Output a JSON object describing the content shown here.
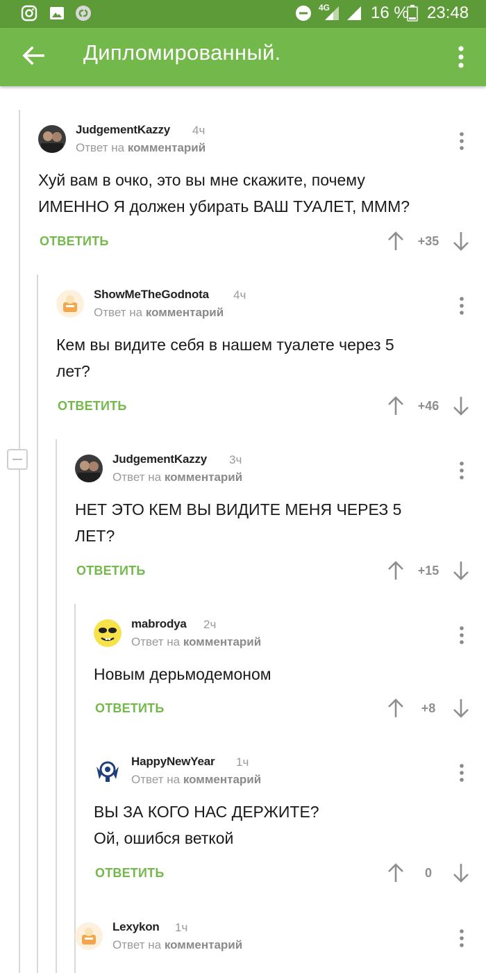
{
  "status_bar": {
    "battery": "16 %",
    "time": "23:48",
    "network": "4G"
  },
  "app_bar": {
    "title": "Дипломированный."
  },
  "reply_label": "ОТВЕТИТЬ",
  "reply_to_prefix": "Ответ на",
  "reply_to_target": "комментарий",
  "comments": [
    {
      "author": "JudgementKazzy",
      "time": "4ч",
      "lines": [
        "Хуй вам в очко, это вы мне скажите, почему",
        "ИМЕННО Я должен убирать ВАШ ТУАЛЕТ, МММ?"
      ],
      "score": "+35",
      "avatar": "photo"
    },
    {
      "author": "ShowMeTheGodnota",
      "time": "4ч",
      "lines": [
        "Кем вы видите себя в нашем туалете через 5",
        "лет?"
      ],
      "score": "+46",
      "avatar": "default"
    },
    {
      "author": "JudgementKazzy",
      "time": "3ч",
      "lines": [
        "НЕТ ЭТО КЕМ ВЫ ВИДИТЕ МЕНЯ ЧЕРЕЗ 5",
        "ЛЕТ?"
      ],
      "score": "+15",
      "avatar": "photo"
    },
    {
      "author": "mabrodya",
      "time": "2ч",
      "lines": [
        "Новым дерьмодемоном"
      ],
      "score": "+8",
      "avatar": "yellow-face"
    },
    {
      "author": "HappyNewYear",
      "time": "1ч",
      "lines": [
        "ВЫ ЗА КОГО НАС ДЕРЖИТЕ?",
        "Ой, ошибся веткой"
      ],
      "score": "0",
      "avatar": "emblem"
    },
    {
      "author": "Lexykon",
      "time": "1ч",
      "lines": [],
      "score": "",
      "avatar": "default"
    }
  ],
  "colors": {
    "status_bar": "#5d9b38",
    "app_bar": "#73b84a",
    "reply_green": "#74b84b"
  }
}
